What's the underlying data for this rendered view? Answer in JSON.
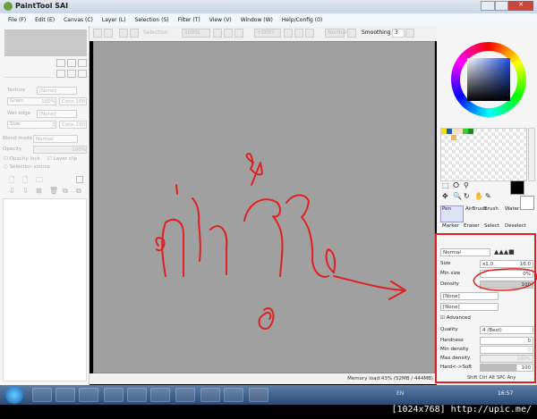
{
  "window": {
    "title": "PaintTool SAI"
  },
  "menu": [
    "File (F)",
    "Edit (E)",
    "Canvas (C)",
    "Layer (L)",
    "Selection (S)",
    "Filter (T)",
    "View (V)",
    "Window (W)",
    "Help/Config (0)"
  ],
  "toolbar": {
    "selection": "Selection",
    "zoom": "100%",
    "angle": "+000?",
    "blend": "Normal",
    "smoothing_label": "Smoothing",
    "smoothing_value": "3"
  },
  "left_panel": {
    "texture_label": "Texture",
    "texture_value": "[None]",
    "grain_label": "Grain",
    "grain_value": "100%",
    "conc1": "Conc 100",
    "wet_edge_label": "Wet edge",
    "wet_edge_value": "[None]",
    "size_label": "Size",
    "size_value": "1",
    "conc2": "Conc 100",
    "blend_mode_label": "Blend mode",
    "blend_mode_value": "Normal",
    "opacity_label": "Opacity",
    "opacity_value": "100%",
    "opacity_lock": "Opacity lock",
    "layer_clip": "Layer clip",
    "selection_source": "Selection source"
  },
  "swatches": [
    "#f5e100",
    "#1f5fa8",
    "#f8dfc0",
    "#f8dfc0",
    "#2ed12e",
    "#208a20",
    "#e8b46a"
  ],
  "tools": [
    "Pen",
    "AirBrush",
    "Brush",
    "Water",
    "Marker",
    "Eraser",
    "Select",
    "Deselect"
  ],
  "brush": {
    "mode": "Normal",
    "size_label": "Size",
    "size_mult": "x1.0",
    "size_value": "16.0",
    "min_size_label": "Min size",
    "min_size_value": "0%",
    "density_label": "Density",
    "density_value": "100",
    "texture1": "[None]",
    "texture2": "[None]",
    "advanced_label": "Advanced",
    "quality_label": "Quality",
    "quality_value": "4 (Best)",
    "hardness_label": "Hardness",
    "hardness_value": "0",
    "min_density_label": "Min density",
    "min_density_value": "0",
    "max_density_label": "Max density",
    "max_density_value": "100%",
    "hard_soft_label": "Hard<->Soft",
    "hard_soft_value": "100"
  },
  "status": {
    "memory": "Memory load:43% (52MB / 444MB)",
    "keys": [
      "Shift",
      "Ctrl",
      "Alt",
      "SPC",
      "Any"
    ]
  },
  "taskbar": {
    "lang": "EN",
    "clock": "16:57"
  },
  "watermark": "[1024x768] http://upic.me/",
  "colors": {
    "annotation": "#e02020",
    "canvas": "#a0a0a0"
  }
}
